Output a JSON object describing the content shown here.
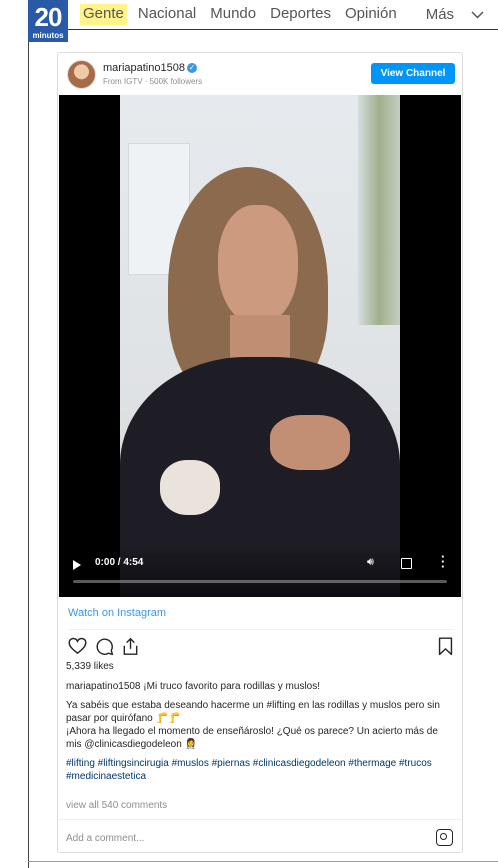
{
  "site": {
    "logo_number": "20",
    "logo_word": "minutos",
    "nav": [
      "Gente",
      "Nacional",
      "Mundo",
      "Deportes",
      "Opinión"
    ],
    "more_label": "Más"
  },
  "post": {
    "username": "mariapatino1508",
    "source": "From IGTV · 500K followers",
    "view_channel": "View Channel",
    "video_time": "0:00 / 4:54",
    "watch_label": "Watch on Instagram",
    "likes": "5,339 likes",
    "caption_title": "¡Mi truco favorito para rodillas y muslos!",
    "caption_p1": "Ya sabéis que estaba deseando hacerme un #lifting en las rodillas y muslos pero sin pasar por quirófano 🦵🦵",
    "caption_p2": "¡Ahora ha llegado el momento de enseñároslo! ¿Qué os parece? Un acierto más de mis @clinicasdiegodeleon 👩‍⚕️",
    "hashtags": "#lifting #liftingsincirugia #muslos #piernas #clinicasdiegodeleon #thermage #trucos #medicinaestetica",
    "view_comments": "view all 540 comments",
    "comment_placeholder": "Add a comment..."
  }
}
